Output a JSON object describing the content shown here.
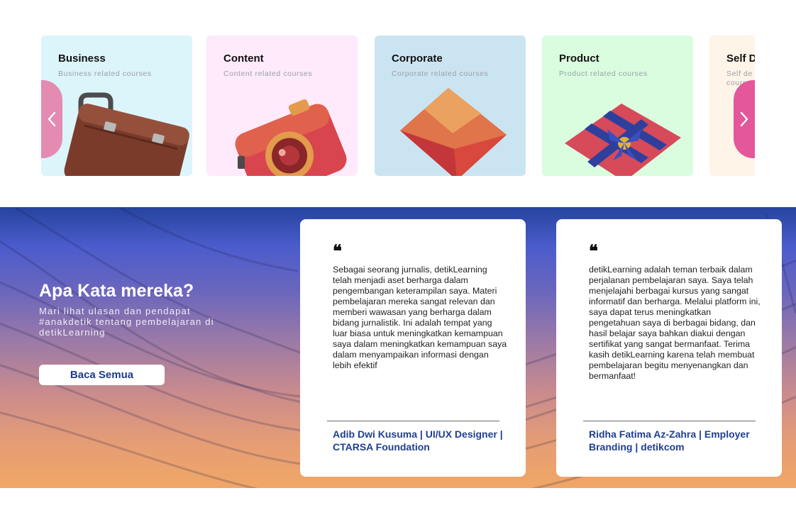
{
  "courses": {
    "items": [
      {
        "title": "Business",
        "subtitle": "Business related courses",
        "bg": "#dbf5fb",
        "icon": "briefcase-icon"
      },
      {
        "title": "Content",
        "subtitle": "Content related courses",
        "bg": "#feeafb",
        "icon": "camera-icon"
      },
      {
        "title": "Corporate",
        "subtitle": "Corporate related courses",
        "bg": "#cbe4f1",
        "icon": "envelope-icon"
      },
      {
        "title": "Product",
        "subtitle": "Product related courses",
        "bg": "#dafde0",
        "icon": "gift-box-icon"
      },
      {
        "title": "Self D",
        "subtitle": "Self de course",
        "bg": "#fff4e8",
        "icon": "self-development-icon"
      }
    ],
    "prev_icon": "chevron-left-icon",
    "next_icon": "chevron-right-icon"
  },
  "testimonials": {
    "heading": "Apa Kata mereka?",
    "subheading": "Mari lihat ulasan dan pendapat #anakdetik tentang pembelajaran di detikLearning",
    "read_all_label": "Baca Semua",
    "quote_mark": "❝",
    "items": [
      {
        "text": "Sebagai seorang jurnalis, detikLearning telah menjadi aset berharga dalam pengembangan keterampilan saya. Materi pembelajaran mereka sangat relevan dan memberi wawasan yang berharga dalam bidang jurnalistik. Ini adalah tempat yang luar biasa untuk meningkatkan kemampuan saya dalam meningkatkan kemampuan saya dalam menyampaikan informasi dengan lebih efektif",
        "author": "Adib Dwi Kusuma | UI/UX Designer | CTARSA Foundation"
      },
      {
        "text": "detikLearning adalah teman terbaik dalam perjalanan pembelajaran saya. Saya telah menjelajahi berbagai kursus yang sangat informatif dan berharga. Melalui platform ini, saya dapat terus meningkatkan pengetahuan saya di berbagai bidang, dan hasil belajar saya bahkan diakui dengan sertifikat yang sangat bermanfaat. Terima kasih detikLearning karena telah membuat pembelajaran begitu menyenangkan dan bermanfaat!",
        "author": "Ridha Fatima Az-Zahra | Employer Branding | detikcom"
      }
    ]
  },
  "colors": {
    "accent_blue": "#1f3f8f",
    "prev_button": "#e48bb2",
    "next_button": "#e4579a"
  }
}
